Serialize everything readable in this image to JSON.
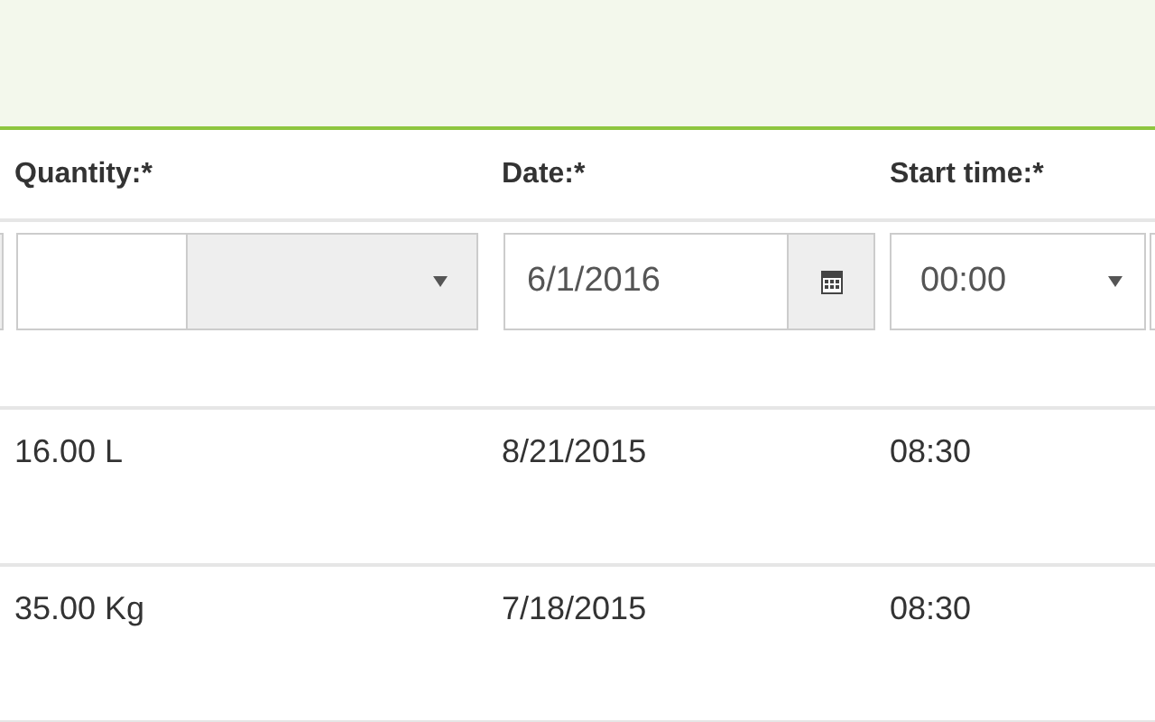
{
  "columns": [
    {
      "label": "Quantity:*"
    },
    {
      "label": "Date:*"
    },
    {
      "label": "Start time:*"
    }
  ],
  "filters": {
    "date": {
      "value": "6/1/2016"
    },
    "start_time": {
      "value": "00:00"
    }
  },
  "rows": [
    {
      "quantity": "16.00 L",
      "date": "8/21/2015",
      "start_time": "08:30"
    },
    {
      "quantity": "35.00 Kg",
      "date": "7/18/2015",
      "start_time": "08:30"
    }
  ]
}
